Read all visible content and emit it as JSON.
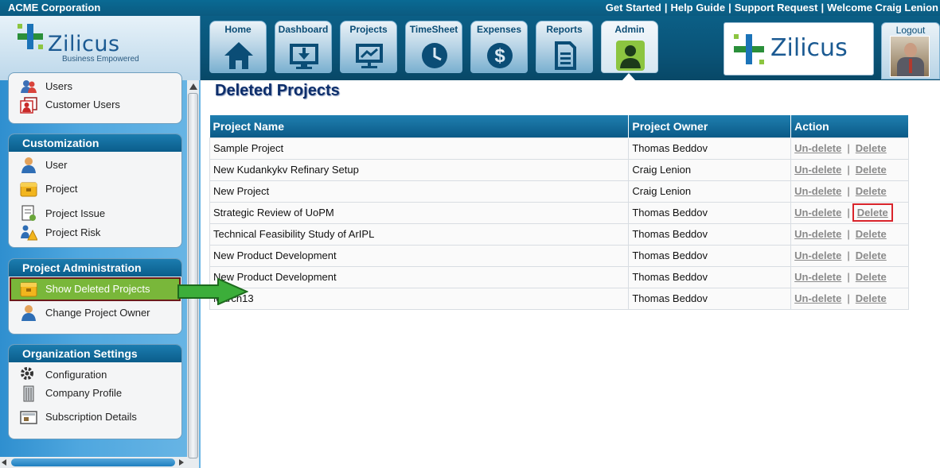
{
  "topbar": {
    "company": "ACME Corporation",
    "links": [
      "Get Started",
      "Help Guide",
      "Support Request"
    ],
    "welcome": "Welcome Craig Lenion"
  },
  "logo": {
    "brand": "Zilicus",
    "tagline": "Business Empowered"
  },
  "nav": {
    "tabs": [
      {
        "label": "Home",
        "icon": "home-icon"
      },
      {
        "label": "Dashboard",
        "icon": "dashboard-icon"
      },
      {
        "label": "Projects",
        "icon": "projects-icon"
      },
      {
        "label": "TimeSheet",
        "icon": "clock-icon"
      },
      {
        "label": "Expenses",
        "icon": "dollar-icon"
      },
      {
        "label": "Reports",
        "icon": "report-icon"
      },
      {
        "label": "Admin",
        "icon": "admin-icon",
        "active": true
      }
    ],
    "logout": "Logout"
  },
  "right_logo": {
    "brand": "Zilicus"
  },
  "sidebar": {
    "users_panel": {
      "items": [
        "Users",
        "Customer Users"
      ]
    },
    "customization": {
      "title": "Customization",
      "items": [
        "User",
        "Project",
        "Project Issue",
        "Project Risk"
      ]
    },
    "project_admin": {
      "title": "Project Administration",
      "items": [
        "Show Deleted Projects",
        "Change Project Owner"
      ],
      "selected": "Show Deleted Projects"
    },
    "org_settings": {
      "title": "Organization Settings",
      "items": [
        "Configuration",
        "Company Profile",
        "Subscription Details"
      ]
    }
  },
  "main": {
    "title": "Deleted Projects",
    "columns": [
      "Project Name",
      "Project Owner",
      "Action"
    ],
    "action_labels": {
      "undelete": "Un-delete",
      "delete": "Delete",
      "separator": "|"
    },
    "rows": [
      {
        "name": "Sample Project",
        "owner": "Thomas Beddov"
      },
      {
        "name": "New Kudankykv Refinary Setup",
        "owner": "Craig Lenion"
      },
      {
        "name": "New Project",
        "owner": "Craig Lenion"
      },
      {
        "name": "Strategic Review of UoPM",
        "owner": "Thomas Beddov",
        "highlight_delete": true
      },
      {
        "name": "Technical Feasibility Study of ArIPL",
        "owner": "Thomas Beddov"
      },
      {
        "name": "New Product Development",
        "owner": "Thomas Beddov"
      },
      {
        "name": "New Product Development",
        "owner": "Thomas Beddov"
      },
      {
        "name": "March13",
        "owner": "Thomas Beddov"
      }
    ]
  },
  "colors": {
    "header_blue": "#0a5377",
    "table_header": "#0b5a87",
    "highlight_green": "#79b73a",
    "annotation_red": "#d9242b",
    "link_gray": "#8a8a8a"
  }
}
